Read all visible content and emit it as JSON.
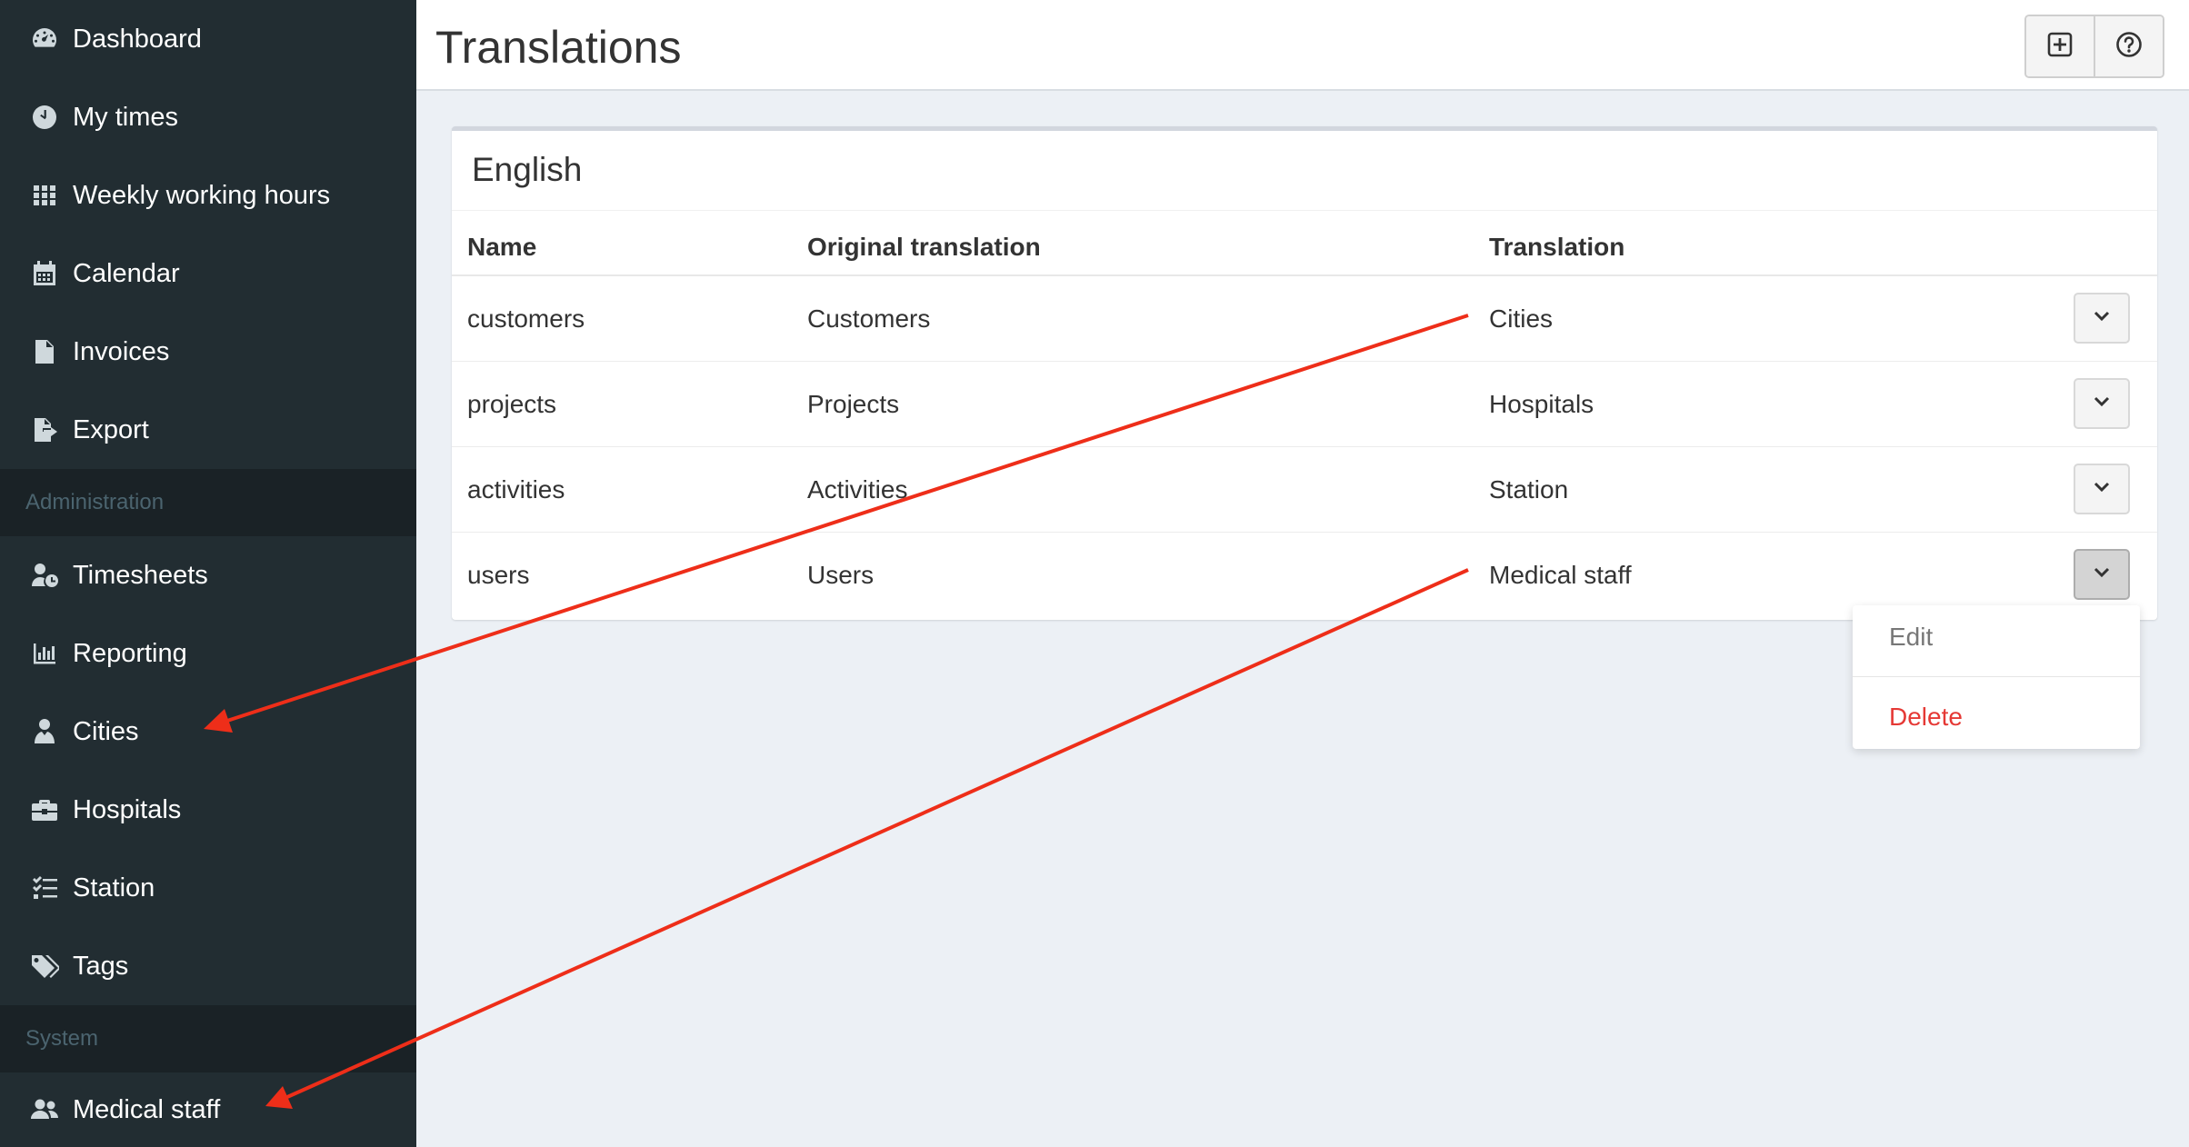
{
  "sidebar": {
    "items": [
      {
        "label": "Dashboard",
        "icon": "dashboard-icon"
      },
      {
        "label": "My times",
        "icon": "clock-icon"
      },
      {
        "label": "Weekly working hours",
        "icon": "grid-icon"
      },
      {
        "label": "Calendar",
        "icon": "calendar-icon"
      },
      {
        "label": "Invoices",
        "icon": "invoice-icon"
      },
      {
        "label": "Export",
        "icon": "export-icon"
      }
    ],
    "admin_header": "Administration",
    "admin_items": [
      {
        "label": "Timesheets",
        "icon": "user-clock-icon"
      },
      {
        "label": "Reporting",
        "icon": "bar-chart-icon"
      },
      {
        "label": "Cities",
        "icon": "user-tie-icon"
      },
      {
        "label": "Hospitals",
        "icon": "briefcase-icon"
      },
      {
        "label": "Station",
        "icon": "tasks-icon"
      },
      {
        "label": "Tags",
        "icon": "tags-icon"
      }
    ],
    "system_header": "System",
    "system_items": [
      {
        "label": "Medical staff",
        "icon": "users-icon"
      }
    ]
  },
  "header": {
    "title": "Translations",
    "buttons": [
      {
        "icon": "plus-square-icon"
      },
      {
        "icon": "help-icon"
      }
    ]
  },
  "box": {
    "title": "English",
    "columns": [
      "Name",
      "Original translation",
      "Translation"
    ],
    "rows": [
      {
        "name": "customers",
        "original": "Customers",
        "translation": "Cities"
      },
      {
        "name": "projects",
        "original": "Projects",
        "translation": "Hospitals"
      },
      {
        "name": "activities",
        "original": "Activities",
        "translation": "Station"
      },
      {
        "name": "users",
        "original": "Users",
        "translation": "Medical staff"
      }
    ]
  },
  "dropdown": {
    "edit": "Edit",
    "delete": "Delete"
  },
  "colors": {
    "sidebar_bg": "#222d32",
    "annotation_arrow": "#ee2e19",
    "delete_text": "#e53935"
  }
}
